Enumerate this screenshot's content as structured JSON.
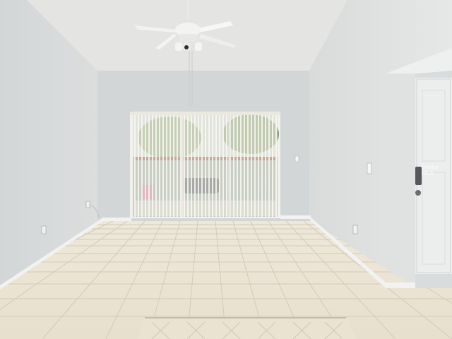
{
  "scene": {
    "description_type": "empty-room-photo",
    "watermark": "Stellar MLS",
    "colors": {
      "wall_left": "#d7dadb",
      "wall_back": "#d2d5d6",
      "wall_right": "#dfe1e1",
      "ceiling": "#e3e4e3",
      "floor_tile": "#ece4d4",
      "grout": "#cfc6b4",
      "door": "#eceeee",
      "blinds": "#efece4"
    },
    "icons": [
      "ceiling-fan-icon",
      "door-lock-icon",
      "light-switch-icon",
      "outlet-icon"
    ]
  }
}
